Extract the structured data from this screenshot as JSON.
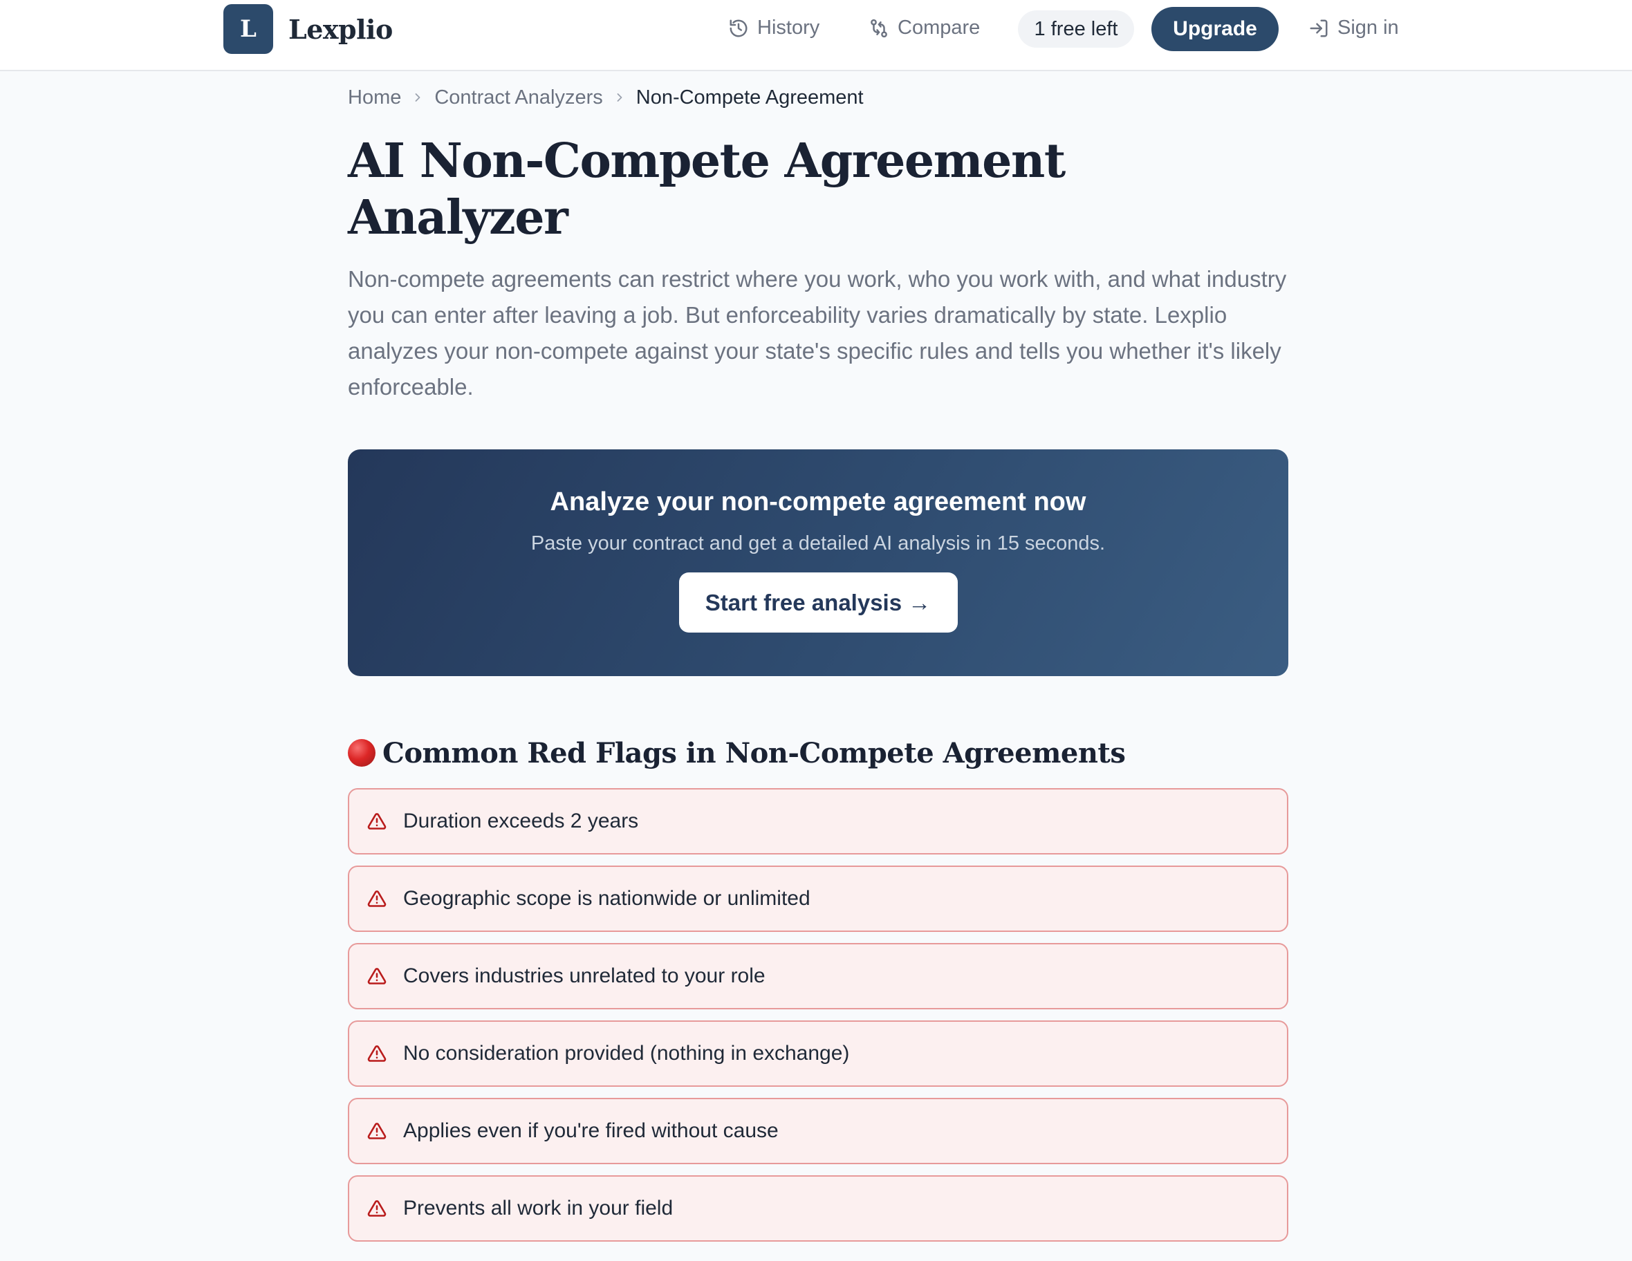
{
  "brand": {
    "logo_letter": "L",
    "name": "Lexplio"
  },
  "nav": {
    "history": "History",
    "compare": "Compare",
    "credits": "1 free left",
    "upgrade": "Upgrade",
    "signin": "Sign in"
  },
  "breadcrumb": [
    "Home",
    "Contract Analyzers",
    "Non-Compete Agreement"
  ],
  "page": {
    "title": "AI Non-Compete Agreement Analyzer",
    "intro": "Non-compete agreements can restrict where you work, who you work with, and what industry you can enter after leaving a job. But enforceability varies dramatically by state. Lexplio analyzes your non-compete against your state's specific rules and tells you whether it's likely enforceable."
  },
  "cta": {
    "title": "Analyze your non-compete agreement now",
    "subtitle": "Paste your contract and get a detailed AI analysis in 15 seconds.",
    "button": "Start free analysis →"
  },
  "red_flags": {
    "title": "Common Red Flags in Non-Compete Agreements",
    "items": [
      "Duration exceeds 2 years",
      "Geographic scope is nationwide or unlimited",
      "Covers industries unrelated to your role",
      "No consideration provided (nothing in exchange)",
      "Applies even if you're fired without cause",
      "Prevents all work in your field"
    ]
  },
  "colors": {
    "brand": "#2c4a6b",
    "flag_border": "#e79a9a",
    "flag_bg": "#fcf0f0",
    "warning": "#b91c1c"
  }
}
